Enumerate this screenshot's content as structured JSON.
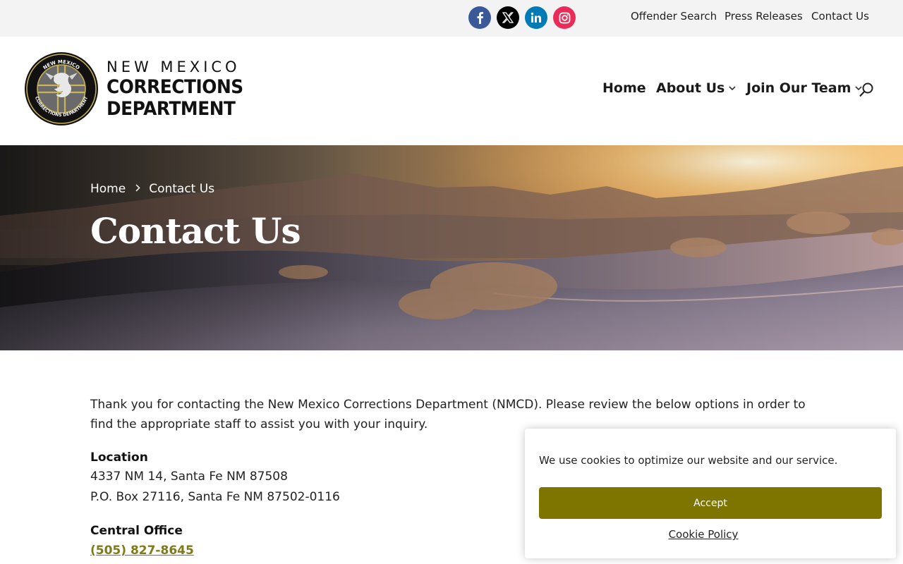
{
  "topbar": {
    "social": [
      {
        "name": "facebook-icon"
      },
      {
        "name": "x-icon"
      },
      {
        "name": "linkedin-icon"
      },
      {
        "name": "instagram-icon"
      }
    ],
    "links": [
      "Offender Search",
      "Press Releases",
      "Contact Us"
    ]
  },
  "logo": {
    "line1": "NEW MEXICO",
    "line2": "CORRECTIONS",
    "line3": "DEPARTMENT",
    "seal_top_text": "NEW MEXICO",
    "seal_bottom_text": "CORRECTIONS DEPARTMENT"
  },
  "nav": {
    "home": "Home",
    "about": "About Us",
    "join": "Join Our Team",
    "dropdown_icon": "chevron-down-icon",
    "search_icon": "search-icon"
  },
  "hero": {
    "breadcrumb_home": "Home",
    "breadcrumb_current": "Contact Us",
    "title": "Contact Us"
  },
  "content": {
    "intro": "Thank you for contacting the New Mexico Corrections Department (NMCD). Please review the below options in order to find the appropriate staff to assist you with your inquiry.",
    "location_heading": "Location",
    "location_line1": "4337 NM 14, Santa Fe NM 87508",
    "location_line2": "P.O. Box 27116, Santa Fe NM 87502-0116",
    "central_heading": "Central Office",
    "central_phone": "(505) 827-8645"
  },
  "cookie": {
    "message": "We use cookies to optimize our website and our service.",
    "accept": "Accept",
    "policy": "Cookie Policy"
  },
  "colors": {
    "topbar_bg": "#f3f3f3",
    "accent_olive": "#7e7400",
    "phone_link": "#7e7a14",
    "facebook": "#3b5998",
    "linkedin": "#007bb6",
    "instagram": "#ea2c59"
  }
}
